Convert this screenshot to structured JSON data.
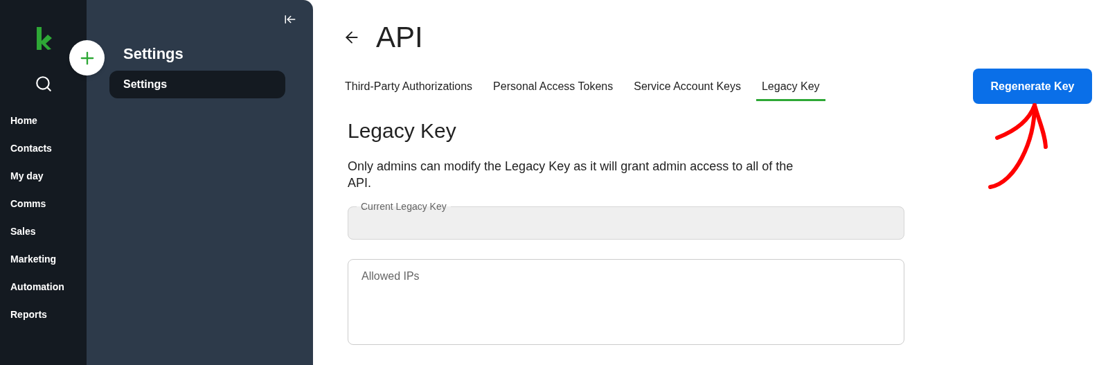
{
  "rail": {
    "items": [
      {
        "label": "Home"
      },
      {
        "label": "Contacts"
      },
      {
        "label": "My day"
      },
      {
        "label": "Comms"
      },
      {
        "label": "Sales"
      },
      {
        "label": "Marketing"
      },
      {
        "label": "Automation"
      },
      {
        "label": "Reports"
      }
    ]
  },
  "panel": {
    "title": "Settings",
    "items": [
      {
        "label": "Settings",
        "selected": true
      }
    ]
  },
  "page": {
    "title": "API",
    "tabs": [
      {
        "label": "Third-Party Authorizations",
        "selected": false
      },
      {
        "label": "Personal Access Tokens",
        "selected": false
      },
      {
        "label": "Service Account Keys",
        "selected": false
      },
      {
        "label": "Legacy Key",
        "selected": true
      }
    ],
    "action": "Regenerate Key",
    "section_title": "Legacy Key",
    "description": "Only admins can modify the Legacy Key as it will grant admin access to all of the API.",
    "fields": [
      {
        "kind": "input",
        "label": "Current Legacy Key",
        "disabled": true
      },
      {
        "kind": "textarea",
        "placeholder": "Allowed IPs",
        "disabled": false
      }
    ]
  }
}
